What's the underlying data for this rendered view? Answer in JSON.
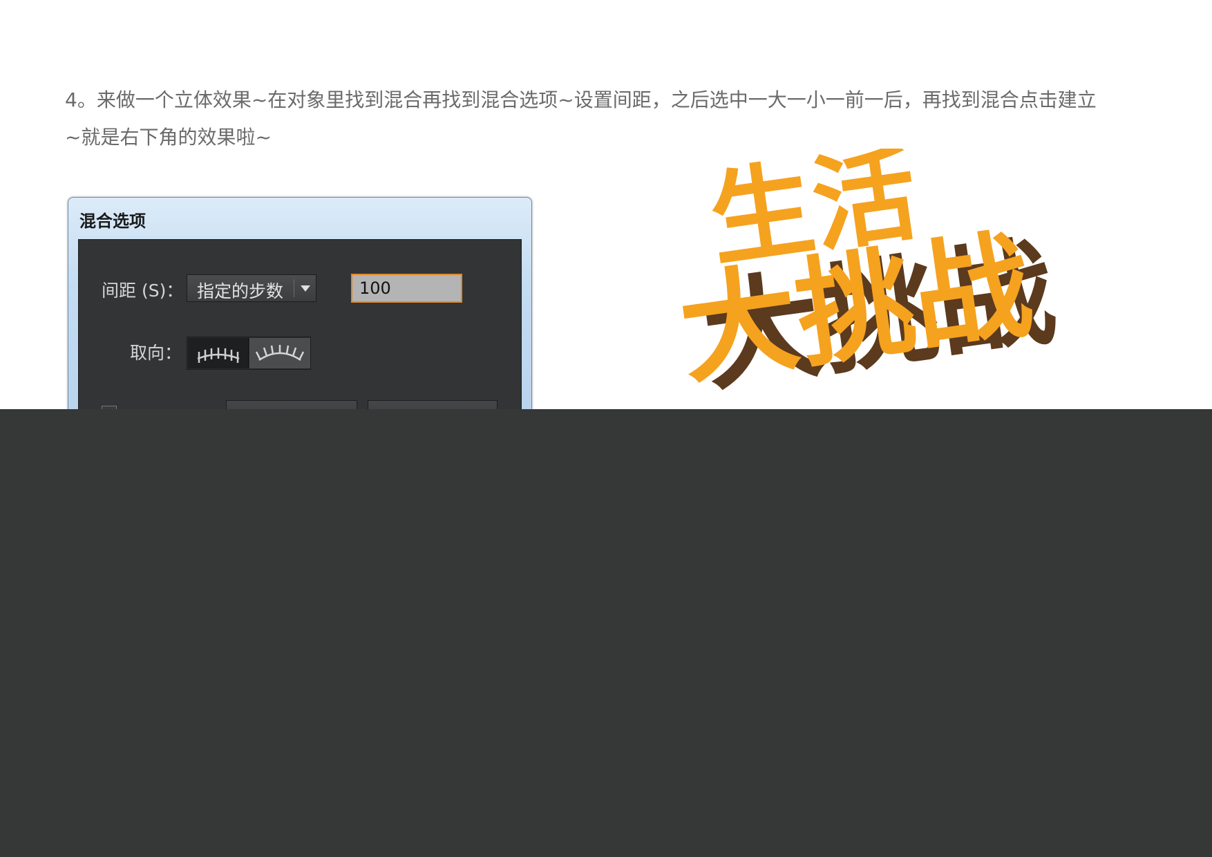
{
  "instructions": {
    "line1": "4。来做一个立体效果~在对象里找到混合再找到混合选项~设置间距，之后选中一大一小一前一后，再找到混合点击建立",
    "line2": "~就是右下角的效果啦~"
  },
  "dialog": {
    "title": "混合选项",
    "spacing_label": "间距 (S)：",
    "spacing_mode": "指定的步数",
    "steps_value": "100",
    "orientation_label": "取向："
  },
  "artwork": {
    "line1": "生活",
    "line2": "大挑战",
    "colors": {
      "front": "#f5a21f",
      "shadow": "#5b3a1e"
    }
  },
  "colors": {
    "instruction_text": "#6a6a6a",
    "dialog_bg": "#323435",
    "input_focus": "#e0882a",
    "dark_panel": "#363838"
  }
}
